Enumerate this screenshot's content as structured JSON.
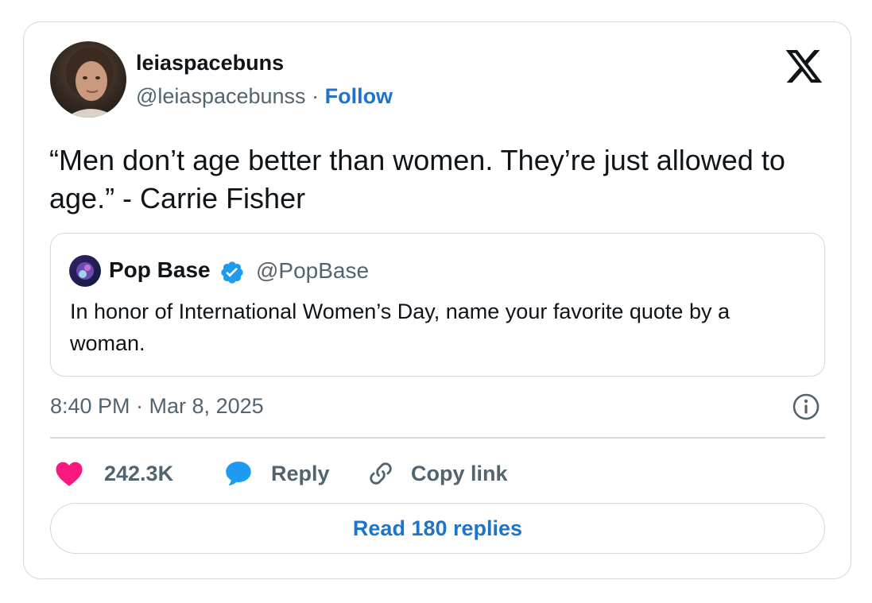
{
  "author": {
    "display_name": "leiaspacebuns",
    "handle": "@leiaspacebunss",
    "separator": "·",
    "follow_label": "Follow"
  },
  "platform_icon": "x-logo-icon",
  "tweet": {
    "text": "“Men don’t age better than women. They’re just allowed to age.” - Carrie Fisher"
  },
  "quote": {
    "display_name": "Pop Base",
    "handle": "@PopBase",
    "verified_icon": "verified-badge-icon",
    "text": "In honor of International Women’s Day, name your favorite quote by a woman."
  },
  "timestamp": "8:40 PM · Mar 8, 2025",
  "actions": {
    "like_count": "242.3K",
    "reply_label": "Reply",
    "copy_label": "Copy link"
  },
  "read_replies_label": "Read 180 replies",
  "colors": {
    "link_blue": "#1d74c9",
    "like_pink": "#f91880",
    "reply_blue": "#1d9bf0",
    "verified_blue": "#1d9bf0",
    "muted_text": "#536471",
    "border": "#cfd9de"
  }
}
